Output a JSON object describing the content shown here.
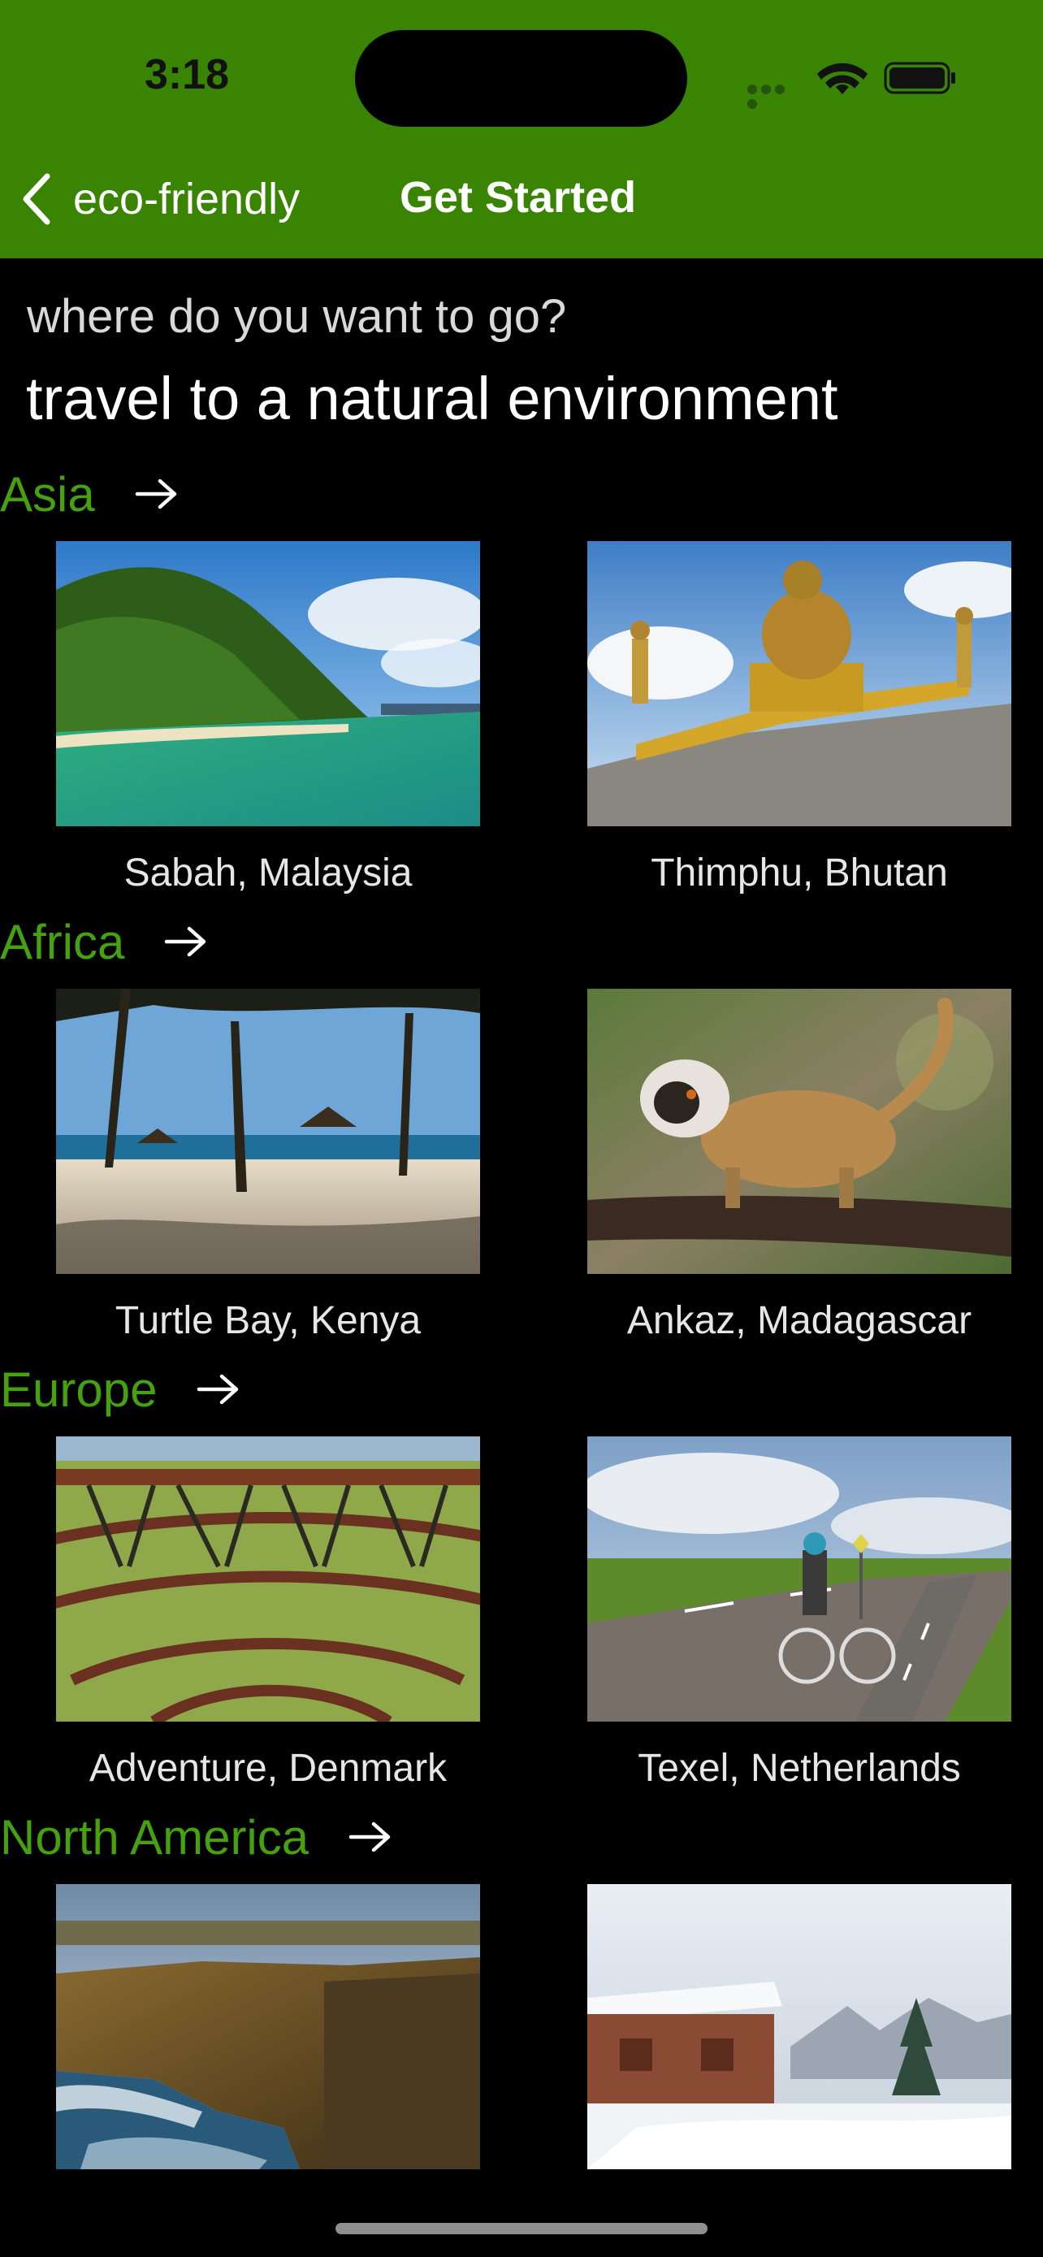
{
  "status_bar": {
    "time": "3:18"
  },
  "nav": {
    "back_label": "eco-friendly",
    "title": "Get Started"
  },
  "intro": {
    "question": "where do you want to go?",
    "headline": "travel to a natural environment"
  },
  "regions": [
    {
      "name": "Asia",
      "destinations": [
        "Sabah, Malaysia",
        "Thimphu, Bhutan"
      ]
    },
    {
      "name": "Africa",
      "destinations": [
        "Turtle Bay, Kenya",
        "Ankaz, Madagascar"
      ]
    },
    {
      "name": "Europe",
      "destinations": [
        "Adventure, Denmark",
        "Texel, Netherlands"
      ]
    },
    {
      "name": "North America",
      "destinations": [
        "",
        ""
      ]
    }
  ],
  "colors": {
    "header_green": "#3a8404",
    "region_green": "#46a10e",
    "background": "#000000"
  },
  "icons": {
    "back": "chevron-left-icon",
    "region_link": "arrow-right-icon"
  }
}
